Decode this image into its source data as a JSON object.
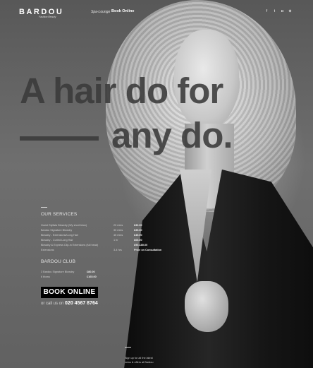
{
  "header": {
    "logo": "BARDOU",
    "logo_sub": "Fashion Beauty",
    "nav_spa": "Spa-Lounge",
    "nav_book": "Book Online",
    "social": [
      {
        "icon": "facebook-icon",
        "glyph": "f"
      },
      {
        "icon": "twitter-icon",
        "glyph": "t"
      },
      {
        "icon": "instagram-icon",
        "glyph": "◘"
      },
      {
        "icon": "pinterest-icon",
        "glyph": "⊕"
      }
    ]
  },
  "hero": {
    "line1": "A hair do for",
    "line2": "any do."
  },
  "services": {
    "title": "OUR SERVICES",
    "items": [
      {
        "name": "Guest Stylists Blowdry (Wy short blow)",
        "duration": "20 mins",
        "price": "£30.00"
      },
      {
        "name": "Bardou Signature Blowdry",
        "duration": "30 mins",
        "price": "£35.00"
      },
      {
        "name": "Blowdry - Extensions/Long Hair",
        "duration": "45 mins",
        "price": "£45.00"
      },
      {
        "name": "Blowdry - Curled Long Hair",
        "duration": "1 hr",
        "price": "£65.00"
      },
      {
        "name": "Blowdry & Express Clip-in Extensions (full head)",
        "duration": "",
        "price": "£90-£80.00"
      },
      {
        "name": "Extensions",
        "duration": "3-4 hrs",
        "price": "Price on Consultation"
      }
    ]
  },
  "club": {
    "title": "BARDOU CLUB",
    "items": [
      {
        "name": "3 Bardou Signature Blowdry",
        "price": "£80.00"
      },
      {
        "name": "6 blows",
        "price": "£165.00"
      }
    ]
  },
  "cta": {
    "book_label": "BOOK ONLINE",
    "call_prefix": "or call us on",
    "phone": "020 4567 8764"
  },
  "footer": {
    "signup_line1": "Sign up for all the latest",
    "signup_line2": "news & offers at Bardou"
  }
}
